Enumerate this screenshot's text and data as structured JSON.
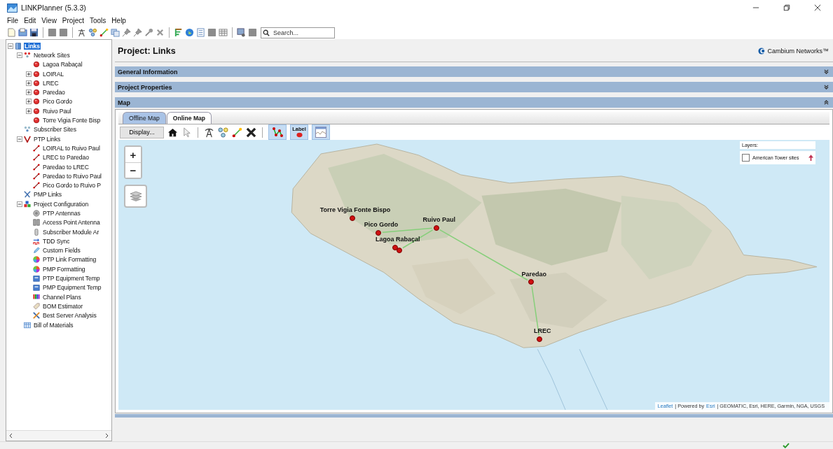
{
  "window": {
    "title": "LINKPlanner (5.3.3)"
  },
  "menu": [
    "File",
    "Edit",
    "View",
    "Project",
    "Tools",
    "Help"
  ],
  "toolbar": {
    "search_placeholder": "Search..."
  },
  "tree": [
    {
      "label": "Links",
      "kind": "root",
      "selected": true,
      "expanded": true,
      "children": [
        {
          "label": "Network Sites",
          "kind": "sites",
          "selected": false,
          "expanded": true,
          "children": [
            {
              "label": "Lagoa Rabaçal",
              "kind": "site",
              "selected": false
            },
            {
              "label": "LOIRAL",
              "kind": "site",
              "selected": false,
              "expanded": false
            },
            {
              "label": "LREC",
              "kind": "site",
              "selected": false,
              "expanded": false
            },
            {
              "label": "Paredao",
              "kind": "site",
              "selected": false,
              "expanded": false
            },
            {
              "label": "Pico Gordo",
              "kind": "site",
              "selected": false,
              "expanded": false
            },
            {
              "label": "Ruivo Paul",
              "kind": "site",
              "selected": false,
              "expanded": false
            },
            {
              "label": "Torre Vigia Fonte Bisp",
              "kind": "site",
              "selected": false
            }
          ]
        },
        {
          "label": "Subscriber Sites",
          "kind": "subscribers",
          "selected": false
        },
        {
          "label": "PTP Links",
          "kind": "ptp",
          "selected": false,
          "expanded": true,
          "children": [
            {
              "label": "LOIRAL to Ruivo Paul",
              "kind": "link",
              "selected": false
            },
            {
              "label": "LREC to Paredao",
              "kind": "link",
              "selected": false
            },
            {
              "label": "Paredao to LREC",
              "kind": "link",
              "selected": false
            },
            {
              "label": "Paredao to Ruivo Paul",
              "kind": "link",
              "selected": false
            },
            {
              "label": "Pico Gordo to Ruivo P",
              "kind": "link",
              "selected": false
            }
          ]
        },
        {
          "label": "PMP Links",
          "kind": "pmp",
          "selected": false
        },
        {
          "label": "Project Configuration",
          "kind": "config",
          "selected": false,
          "expanded": true,
          "children": [
            {
              "label": "PTP Antennas",
              "kind": "antenna",
              "selected": false
            },
            {
              "label": "Access Point Antenna",
              "kind": "ap-antenna",
              "selected": false
            },
            {
              "label": "Subscriber Module Ar",
              "kind": "sm-antenna",
              "selected": false
            },
            {
              "label": "TDD Sync",
              "kind": "tdd",
              "selected": false
            },
            {
              "label": "Custom Fields",
              "kind": "fields",
              "selected": false
            },
            {
              "label": "PTP Link Formatting",
              "kind": "formatting",
              "selected": false
            },
            {
              "label": "PMP Formatting",
              "kind": "formatting",
              "selected": false
            },
            {
              "label": "PTP Equipment Temp",
              "kind": "equipment",
              "selected": false
            },
            {
              "label": "PMP Equipment Temp",
              "kind": "equipment",
              "selected": false
            },
            {
              "label": "Channel Plans",
              "kind": "channels",
              "selected": false
            },
            {
              "label": "BOM Estimator",
              "kind": "estimator",
              "selected": false
            },
            {
              "label": "Best Server Analysis",
              "kind": "best-server",
              "selected": false
            }
          ]
        },
        {
          "label": "Bill of Materials",
          "kind": "bom",
          "selected": false
        }
      ]
    }
  ],
  "project": {
    "title": "Project: Links",
    "brand": "Cambium Networks™"
  },
  "sections": [
    {
      "title": "General Information",
      "expanded": false
    },
    {
      "title": "Project Properties",
      "expanded": false
    },
    {
      "title": "Map",
      "expanded": true
    }
  ],
  "map": {
    "tabs": [
      {
        "label": "Offline Map",
        "selected": false
      },
      {
        "label": "Online Map",
        "selected": true
      }
    ],
    "display_button": "Display...",
    "toggles": [
      {
        "kind": "links",
        "selected": true
      },
      {
        "kind": "labels",
        "text": "Label",
        "selected": true
      },
      {
        "kind": "profile",
        "selected": true
      }
    ],
    "zoom_controls": [
      "+",
      "−"
    ],
    "layers": {
      "title": "Layers:",
      "items": [
        {
          "label": "American Tower sites",
          "checked": false
        }
      ]
    },
    "sites": [
      {
        "name": "Torre Vigia Fonte Bispo"
      },
      {
        "name": "Pico Gordo"
      },
      {
        "name": "Ruivo Paul"
      },
      {
        "name": "Lagoa Rabaçal"
      },
      {
        "name": "Paredao"
      },
      {
        "name": "LREC"
      }
    ],
    "attribution": [
      {
        "text": "Leaflet",
        "link": true
      },
      {
        "text": "| Powered by",
        "link": false
      },
      {
        "text": "Esri",
        "link": true
      },
      {
        "text": "| GEOMATIC, Esri, HERE, Garmin, NGA, USGS",
        "link": false
      }
    ]
  }
}
